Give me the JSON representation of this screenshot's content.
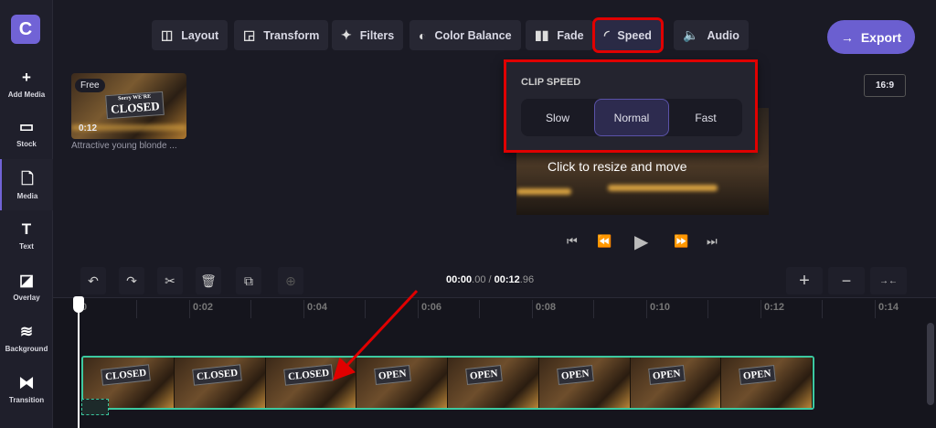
{
  "app": {
    "logo_letter": "C",
    "accent": "#7163d6",
    "highlight": "#e00000",
    "clip_border": "#3cc9a0"
  },
  "sidebar": {
    "items": [
      {
        "label": "Add Media",
        "icon": "plus-icon",
        "glyph": "+"
      },
      {
        "label": "Stock",
        "icon": "stock-icon",
        "glyph": "▭"
      },
      {
        "label": "Media",
        "icon": "file-icon",
        "glyph": "🗋"
      },
      {
        "label": "Text",
        "icon": "text-icon",
        "glyph": "T"
      },
      {
        "label": "Overlay",
        "icon": "overlay-icon",
        "glyph": "◪"
      },
      {
        "label": "Background",
        "icon": "layers-icon",
        "glyph": "≋"
      },
      {
        "label": "Transition",
        "icon": "transition-icon",
        "glyph": "⧓"
      }
    ]
  },
  "toolbar": {
    "items": [
      {
        "label": "Layout",
        "icon": "layout-icon",
        "glyph": "◫"
      },
      {
        "label": "Transform",
        "icon": "transform-icon",
        "glyph": "◲"
      },
      {
        "label": "Filters",
        "icon": "sparkle-icon",
        "glyph": "✦"
      },
      {
        "label": "Color Balance",
        "icon": "color-balance-icon",
        "glyph": "◐"
      },
      {
        "label": "Fade",
        "icon": "fade-icon",
        "glyph": "▮▮"
      },
      {
        "label": "Speed",
        "icon": "speedometer-icon",
        "glyph": "◜"
      },
      {
        "label": "Audio",
        "icon": "speaker-icon",
        "glyph": "🔈"
      }
    ],
    "active": "Speed"
  },
  "export": {
    "label": "Export",
    "glyph": "→"
  },
  "aspect_ratio": "16:9",
  "media": {
    "badge": "Free",
    "duration": "0:12",
    "caption": "Attractive young blonde ...",
    "sign_top": "Sorry WE'RE",
    "sign": "CLOSED"
  },
  "preview": {
    "hint": "Click to resize and move"
  },
  "clip_speed": {
    "title": "CLIP SPEED",
    "options": [
      "Slow",
      "Normal",
      "Fast"
    ],
    "selected": "Normal"
  },
  "playback": {
    "controls": [
      "⏮",
      "⏪",
      "▶",
      "⏩",
      "⏭"
    ]
  },
  "timeline": {
    "current": "00:00",
    "current_frac": ".00",
    "total": "00:12",
    "total_frac": ".96",
    "separator": "/",
    "ticks": [
      "0",
      "0:02",
      "0:04",
      "0:06",
      "0:08",
      "0:10",
      "0:12",
      "0:14"
    ],
    "left_buttons": [
      {
        "name": "undo",
        "glyph": "↶"
      },
      {
        "name": "redo",
        "glyph": "↷"
      },
      {
        "name": "split",
        "glyph": "✂"
      },
      {
        "name": "delete",
        "glyph": "🗑"
      },
      {
        "name": "duplicate",
        "glyph": "⧉"
      },
      {
        "name": "add-to-track",
        "glyph": "⊕"
      }
    ],
    "right_buttons": [
      {
        "name": "zoom-in",
        "glyph": "+"
      },
      {
        "name": "zoom-out",
        "glyph": "−"
      },
      {
        "name": "fit",
        "glyph": "→←"
      }
    ],
    "frames": [
      "CLOSED",
      "CLOSED",
      "CLOSED",
      "OPEN",
      "OPEN",
      "OPEN",
      "OPEN",
      "OPEN"
    ]
  }
}
